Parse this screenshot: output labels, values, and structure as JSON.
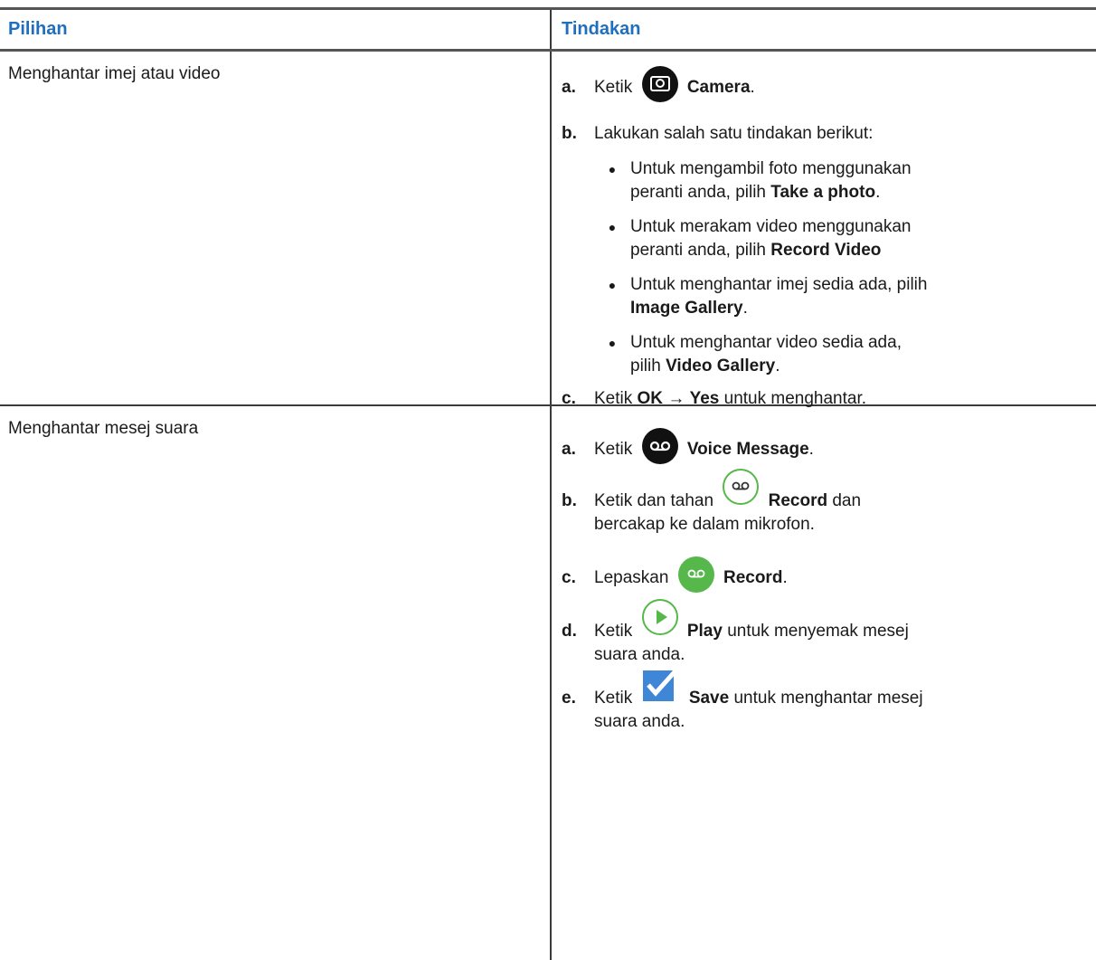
{
  "header": {
    "col1": "Pilihan",
    "col2": "Tindakan"
  },
  "rows": [
    {
      "option": "Menghantar imej atau video",
      "steps": [
        {
          "letter": "a.",
          "before": "Ketik",
          "icon": "camera-icon",
          "bold": "Camera",
          "after": "."
        },
        {
          "letter": "b.",
          "before": "Lakukan salah satu tindakan berikut:"
        },
        {
          "letter": "c.",
          "before": "Ketik",
          "bold": "OK",
          "arrow": "→",
          "bold2": "Yes",
          "after": "untuk menghantar."
        }
      ],
      "bullets": [
        {
          "l1": "Untuk mengambil foto menggunakan",
          "l2a": "peranti anda, pilih",
          "bold": "Take a photo",
          "after": "."
        },
        {
          "l1": "Untuk merakam video menggunakan",
          "l2a": "peranti anda, pilih",
          "bold": "Record Video",
          "after": ""
        },
        {
          "l1": "Untuk menghantar imej sedia ada, pilih",
          "l2a": "",
          "bold": "Image Gallery",
          "after": "."
        },
        {
          "l1": "Untuk menghantar video sedia ada,",
          "l2a": "pilih",
          "bold": "Video Gallery",
          "after": "."
        }
      ]
    },
    {
      "option": "Menghantar mesej suara",
      "steps": [
        {
          "letter": "a.",
          "before": "Ketik",
          "icon": "voicemail-icon",
          "bold": "Voice Message",
          "after": "."
        },
        {
          "letter": "b.",
          "before": "Ketik dan tahan",
          "icon": "record-outline-icon",
          "bold": "Record",
          "after": "dan",
          "line2": "bercakap ke dalam mikrofon."
        },
        {
          "letter": "c.",
          "before": "Lepaskan",
          "icon": "record-filled-icon",
          "bold": "Record",
          "after": "."
        },
        {
          "letter": "d.",
          "before": "Ketik",
          "icon": "play-icon",
          "bold": "Play",
          "after": "untuk menyemak mesej",
          "line2": "suara anda."
        },
        {
          "letter": "e.",
          "before": "Ketik",
          "icon": "checkmark-icon",
          "bold": "Save",
          "after": "untuk menghantar mesej",
          "line2": "suara anda."
        }
      ]
    }
  ],
  "colors": {
    "header_text": "#1f6fbd",
    "green": "#56b84a",
    "check_blue": "#3f86d6"
  }
}
